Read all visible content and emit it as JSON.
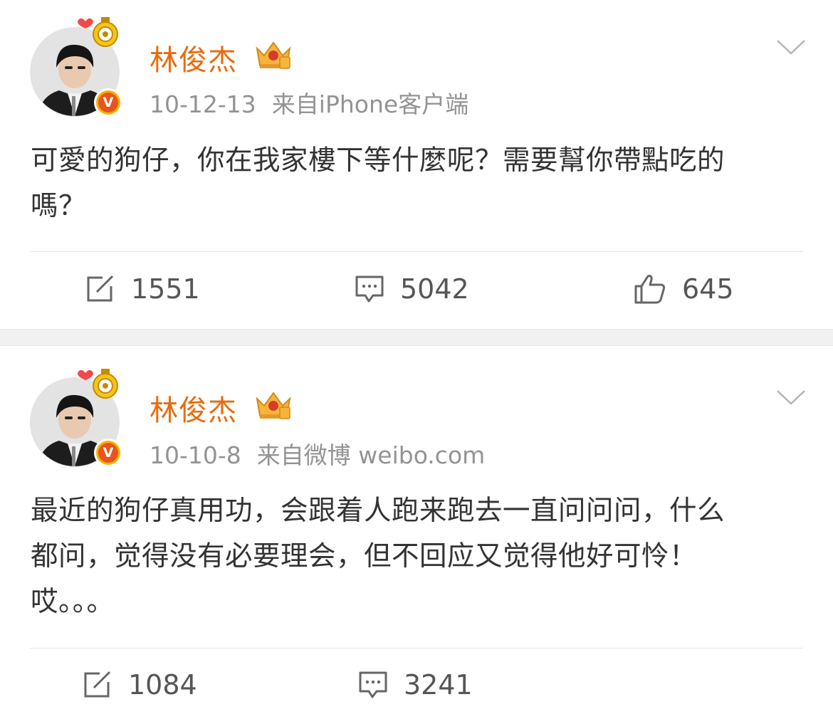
{
  "posts": [
    {
      "username": "林俊杰",
      "date": "10-12-13",
      "source": "来自iPhone客户端",
      "text_lines": [
        "可愛的狗仔，你在我家樓下等什麼呢？需要幫你帶點吃的",
        "嗎？"
      ],
      "verified_mark": "V",
      "repost_count": "1551",
      "comment_count": "5042",
      "like_count": "645"
    },
    {
      "username": "林俊杰",
      "date": "10-10-8",
      "source": "来自微博 weibo.com",
      "text_lines": [
        "最近的狗仔真用功，会跟着人跑来跑去一直问问问，什么",
        "都问，觉得没有必要理会，但不回应又觉得他好可怜！",
        "哎。。。"
      ],
      "verified_mark": "V",
      "repost_count": "1084",
      "comment_count": "3241"
    }
  ],
  "icons": {
    "repost": "repost-icon",
    "comment": "comment-icon",
    "like": "like-icon",
    "more": "chevron-down-icon",
    "crown": "crown-badge-icon",
    "verified": "verified-badge-icon"
  },
  "colors": {
    "username": "#e86b0c",
    "meta": "#939393",
    "text": "#333333",
    "action": "#555555",
    "separator": "#f1f1f1"
  }
}
